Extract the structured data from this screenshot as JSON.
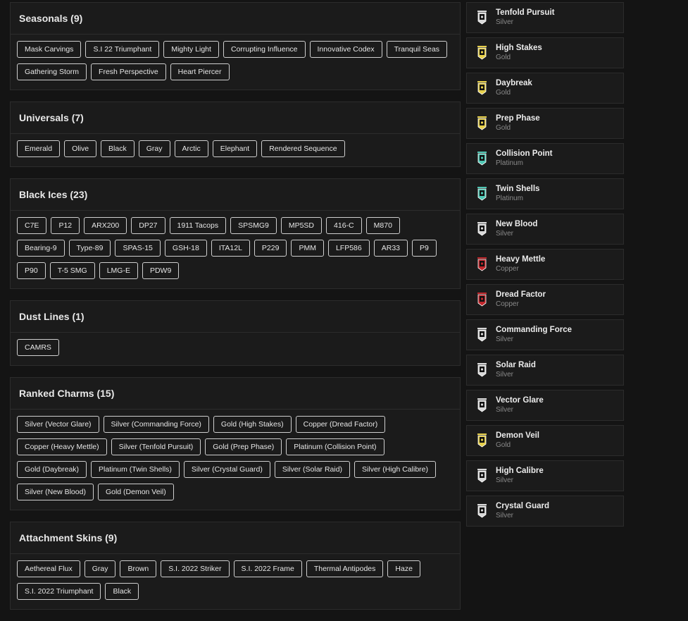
{
  "sections": [
    {
      "title": "Seasonals (9)",
      "items": [
        "Mask Carvings",
        "S.I 22 Triumphant",
        "Mighty Light",
        "Corrupting Influence",
        "Innovative Codex",
        "Tranquil Seas",
        "Gathering Storm",
        "Fresh Perspective",
        "Heart Piercer"
      ]
    },
    {
      "title": "Universals (7)",
      "items": [
        "Emerald",
        "Olive",
        "Black",
        "Gray",
        "Arctic",
        "Elephant",
        "Rendered Sequence"
      ]
    },
    {
      "title": "Black Ices (23)",
      "items": [
        "C7E",
        "P12",
        "ARX200",
        "DP27",
        "1911 Tacops",
        "SPSMG9",
        "MP5SD",
        "416-C",
        "M870",
        "Bearing-9",
        "Type-89",
        "SPAS-15",
        "GSH-18",
        "ITA12L",
        "P229",
        "PMM",
        "LFP586",
        "AR33",
        "P9",
        "P90",
        "T-5 SMG",
        "LMG-E",
        "PDW9"
      ]
    },
    {
      "title": "Dust Lines (1)",
      "items": [
        "CAMRS"
      ]
    },
    {
      "title": "Ranked Charms (15)",
      "items": [
        "Silver (Vector Glare)",
        "Silver (Commanding Force)",
        "Gold (High Stakes)",
        "Copper (Dread Factor)",
        "Copper (Heavy Mettle)",
        "Silver (Tenfold Pursuit)",
        "Gold (Prep Phase)",
        "Platinum (Collision Point)",
        "Gold (Daybreak)",
        "Platinum (Twin Shells)",
        "Silver (Crystal Guard)",
        "Silver (Solar Raid)",
        "Silver (High Calibre)",
        "Silver (New Blood)",
        "Gold (Demon Veil)"
      ]
    },
    {
      "title": "Attachment Skins (9)",
      "items": [
        "Aethereal Flux",
        "Gray",
        "Brown",
        "S.I. 2022 Striker",
        "S.I. 2022 Frame",
        "Thermal Antipodes",
        "Haze",
        "S.I. 2022 Triumphant",
        "Black"
      ]
    }
  ],
  "ranks": [
    {
      "name": "Tenfold Pursuit",
      "tier": "Silver",
      "icon": "silver-rank-icon"
    },
    {
      "name": "High Stakes",
      "tier": "Gold",
      "icon": "gold-rank-icon"
    },
    {
      "name": "Daybreak",
      "tier": "Gold",
      "icon": "gold-rank-icon"
    },
    {
      "name": "Prep Phase",
      "tier": "Gold",
      "icon": "gold-rank-icon"
    },
    {
      "name": "Collision Point",
      "tier": "Platinum",
      "icon": "platinum-rank-icon"
    },
    {
      "name": "Twin Shells",
      "tier": "Platinum",
      "icon": "platinum-rank-icon"
    },
    {
      "name": "New Blood",
      "tier": "Silver",
      "icon": "silver-rank-icon"
    },
    {
      "name": "Heavy Mettle",
      "tier": "Copper",
      "icon": "copper-rank-icon"
    },
    {
      "name": "Dread Factor",
      "tier": "Copper",
      "icon": "copper-rank-icon"
    },
    {
      "name": "Commanding Force",
      "tier": "Silver",
      "icon": "silver-rank-icon"
    },
    {
      "name": "Solar Raid",
      "tier": "Silver",
      "icon": "silver-rank-icon"
    },
    {
      "name": "Vector Glare",
      "tier": "Silver",
      "icon": "silver-rank-icon"
    },
    {
      "name": "Demon Veil",
      "tier": "Gold",
      "icon": "gold-rank-icon"
    },
    {
      "name": "High Calibre",
      "tier": "Silver",
      "icon": "silver-rank-icon"
    },
    {
      "name": "Crystal Guard",
      "tier": "Silver",
      "icon": "silver-rank-icon"
    }
  ],
  "tier_colors": {
    "Silver": "#d9d9d9",
    "Gold": "#e6cf4a",
    "Platinum": "#4fc7b4",
    "Copper": "#c0262b"
  }
}
